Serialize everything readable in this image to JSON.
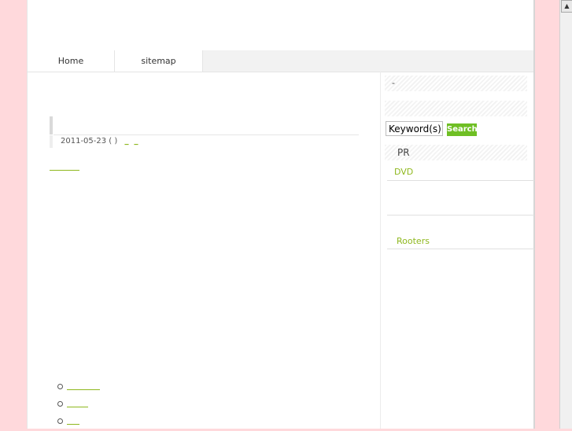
{
  "nav": {
    "home": "Home",
    "sitemap": "sitemap"
  },
  "post": {
    "date": "2011-05-23 ( )",
    "link1": "_",
    "link2": "_"
  },
  "sidebar": {
    "box1": "-",
    "search_value": "Keyword(s)",
    "search_button": "Search",
    "pr_title": "PR",
    "link_dvd": "DVD",
    "link_rooters": "Rooters"
  },
  "colors": {
    "background": "#ffd9dc",
    "accent": "#8fb81e",
    "button": "#6fbf24"
  },
  "scrollbar": {
    "up_icon": "arrow-up-icon"
  }
}
